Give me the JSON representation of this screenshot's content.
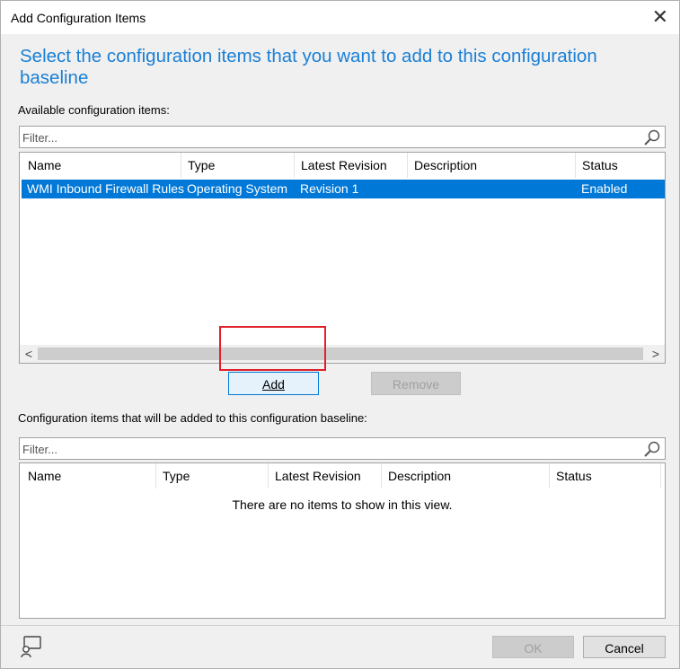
{
  "window": {
    "title": "Add Configuration Items",
    "close_glyph": "✕"
  },
  "heading": "Select the configuration items that you want to add to this configuration baseline",
  "available": {
    "label": "Available configuration items:",
    "filter_placeholder": "Filter...",
    "columns": [
      "Name",
      "Type",
      "Latest Revision",
      "Description",
      "Status"
    ],
    "rows": [
      {
        "name": "WMI Inbound Firewall Rules",
        "type": "Operating System",
        "revision": "Revision 1",
        "description": "",
        "status": "Enabled",
        "selected": true
      }
    ],
    "scroll_left": "<",
    "scroll_right": ">"
  },
  "buttons": {
    "add": "Add",
    "remove": "Remove",
    "ok": "OK",
    "cancel": "Cancel"
  },
  "selected_items": {
    "label": "Configuration items that will be added to this configuration baseline:",
    "filter_placeholder": "Filter...",
    "columns": [
      "Name",
      "Type",
      "Latest Revision",
      "Description",
      "Status"
    ],
    "empty_message": "There are no items to show in this view."
  },
  "colors": {
    "accent": "#1a7fd6",
    "selection": "#0078d7",
    "highlight_border": "#e0202a"
  },
  "icons": [
    "close-icon",
    "search-icon",
    "help-icon"
  ]
}
